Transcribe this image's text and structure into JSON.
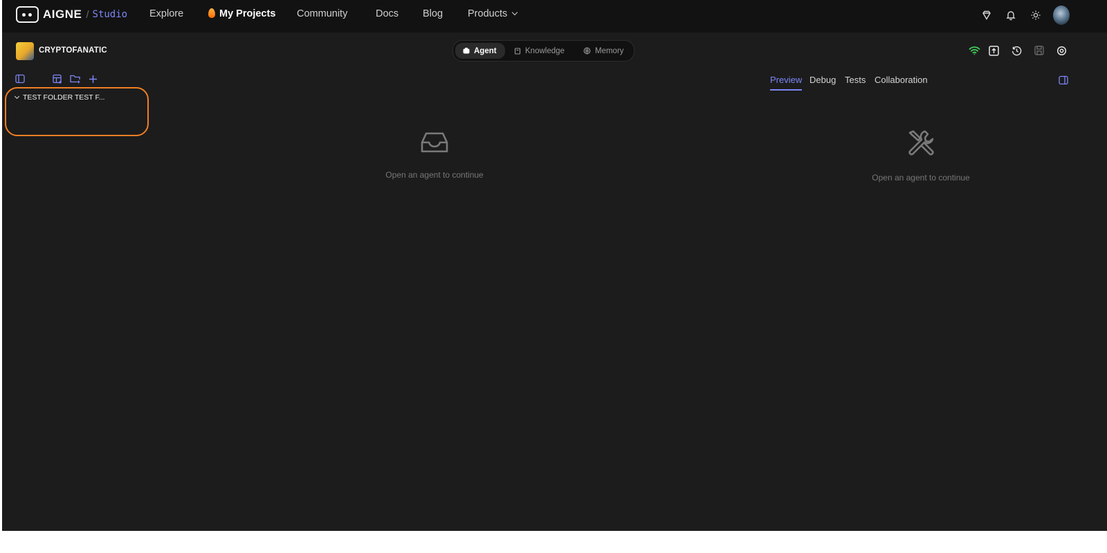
{
  "brand": {
    "name": "AIGNE",
    "separator": "/",
    "product": "Studio"
  },
  "nav": {
    "explore": "Explore",
    "my_projects": "My Projects",
    "community": "Community",
    "docs": "Docs",
    "blog": "Blog",
    "products": "Products"
  },
  "project": {
    "name": "CRYPTOFANATIC"
  },
  "segments": {
    "agent": "Agent",
    "knowledge": "Knowledge",
    "memory": "Memory"
  },
  "tree": {
    "folder": "TEST FOLDER TEST F..."
  },
  "center_empty": {
    "text": "Open an agent to continue"
  },
  "right_tabs": [
    "Preview",
    "Debug",
    "Tests",
    "Collaboration"
  ],
  "right_empty": {
    "text": "Open an agent to continue"
  },
  "colors": {
    "accent": "#7d86f5",
    "highlight": "#f07f23",
    "online": "#3ecf5a"
  }
}
